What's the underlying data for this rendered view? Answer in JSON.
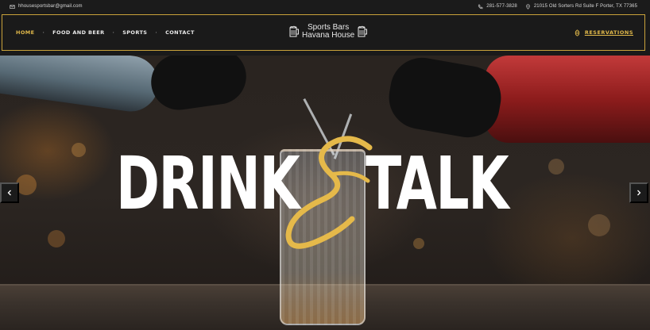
{
  "topbar": {
    "email": "hhousesportsbar@gmail.com",
    "phone": "281-577-3828",
    "address": "21015 Old Sorters Rd Suite F Porter, TX 77365"
  },
  "nav": {
    "items": [
      {
        "label": "HOME",
        "active": true
      },
      {
        "label": "FOOD AND BEER",
        "active": false
      },
      {
        "label": "SPORTS",
        "active": false
      },
      {
        "label": "CONTACT",
        "active": false
      }
    ],
    "separator": "·"
  },
  "logo": {
    "line1": "Sports Bars",
    "line2": "Havana House",
    "icon": "beer-mug-icon"
  },
  "reservations": {
    "label": "RESERVATIONS",
    "icon": "hops-icon"
  },
  "hero": {
    "word_left": "DRINK",
    "word_right": "TALK",
    "ampersand": "&",
    "slider_prev_icon": "chevron-left-icon",
    "slider_next_icon": "chevron-right-icon"
  },
  "colors": {
    "accent": "#e0b84a",
    "border": "#c9a23b",
    "background": "#1a1a1a"
  }
}
